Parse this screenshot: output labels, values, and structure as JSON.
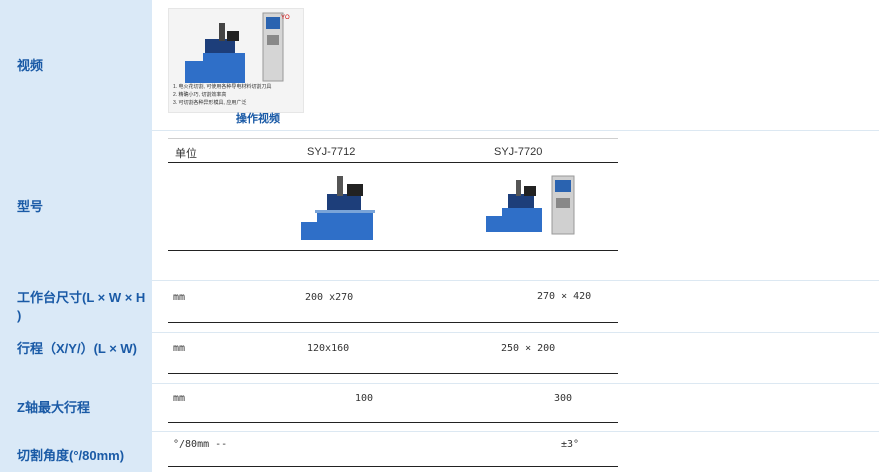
{
  "sidebar": {
    "video": "视频",
    "model": "型号",
    "table_size": "工作台尺寸(L × W × H )",
    "travel": "行程（X/Y/）(L × W)",
    "z_travel": "Z轴最大行程",
    "cut_angle": "切割角度(°/80mm)"
  },
  "video": {
    "caption": "操作视频",
    "lines": [
      "1. 电火花切割, 可使用各种导电材料切割刀具",
      "2. 精确小巧, 切割效率高",
      "3. 可切割各种异形模具, 应用广泛"
    ]
  },
  "table": {
    "header_unit": "单位",
    "models": [
      "SYJ-7712",
      "SYJ-7720"
    ],
    "rows": [
      {
        "unit": "mm",
        "v1": "200 x270",
        "v2": "270 × 420"
      },
      {
        "unit": "mm",
        "v1": "120x160",
        "v2": "250 × 200"
      },
      {
        "unit": "mm",
        "v1": "100",
        "v2": "300"
      },
      {
        "unit": "°/80mm  --",
        "v1": "",
        "v2": "±3°"
      }
    ]
  },
  "colors": {
    "sidebar_bg": "#dae9f7",
    "label_text": "#1a5aa6",
    "machine_blue": "#2f6fc8"
  }
}
